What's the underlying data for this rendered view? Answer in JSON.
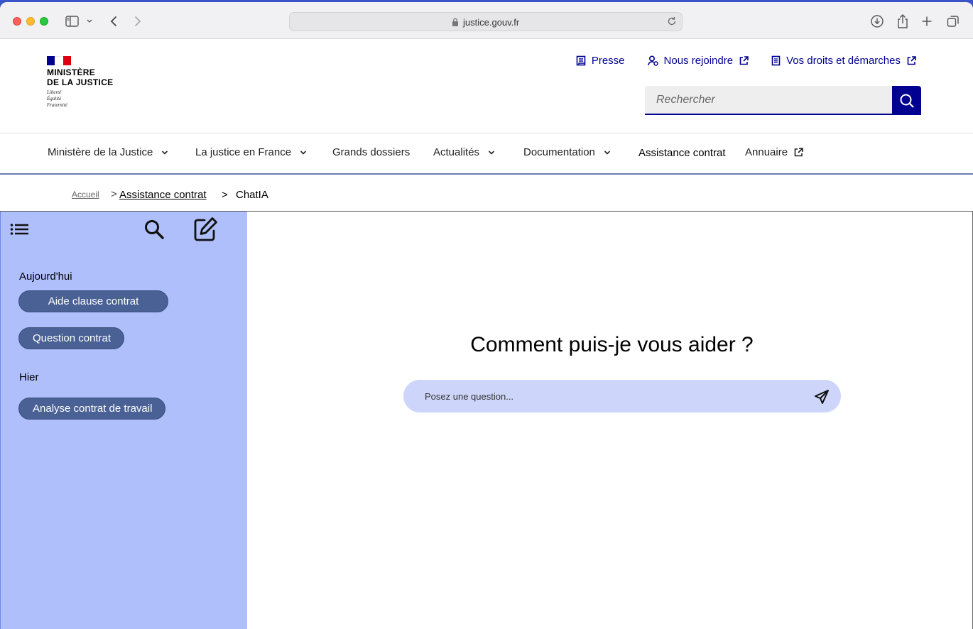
{
  "browser": {
    "url": "justice.gouv.fr"
  },
  "logo": {
    "line1": "MINISTÈRE",
    "line2": "DE LA JUSTICE",
    "motto1": "Liberté",
    "motto2": "Égalité",
    "motto3": "Fraternité"
  },
  "toplinks": [
    {
      "label": "Presse"
    },
    {
      "label": "Nous rejoindre"
    },
    {
      "label": "Vos droits et démarches"
    }
  ],
  "search": {
    "placeholder": "Rechercher"
  },
  "nav": [
    {
      "label": "Ministère de la Justice"
    },
    {
      "label": "La justice en France"
    },
    {
      "label": "Grands dossiers"
    },
    {
      "label": "Actualités"
    },
    {
      "label": "Documentation"
    },
    {
      "label": "Assistance contrat"
    },
    {
      "label": "Annuaire"
    }
  ],
  "breadcrumb": {
    "home": "Accueil",
    "sep1": ">",
    "parent": "Assistance contrat",
    "sep2": ">",
    "current": "ChatIA"
  },
  "sidebar": {
    "today_label": "Aujourd'hui",
    "today": [
      {
        "label": "Aide clause contrat"
      },
      {
        "label": "Question contrat"
      }
    ],
    "yesterday_label": "Hier",
    "yesterday": [
      {
        "label": "Analyse contrat de travail"
      }
    ]
  },
  "chat": {
    "headline": "Comment puis-je vous aider ?",
    "placeholder": "Posez une question..."
  },
  "colors": {
    "brand_blue": "#000091",
    "sidebar_bg": "#afbffc",
    "chip_bg": "#4a6195",
    "input_bg": "#cdd6fa"
  }
}
